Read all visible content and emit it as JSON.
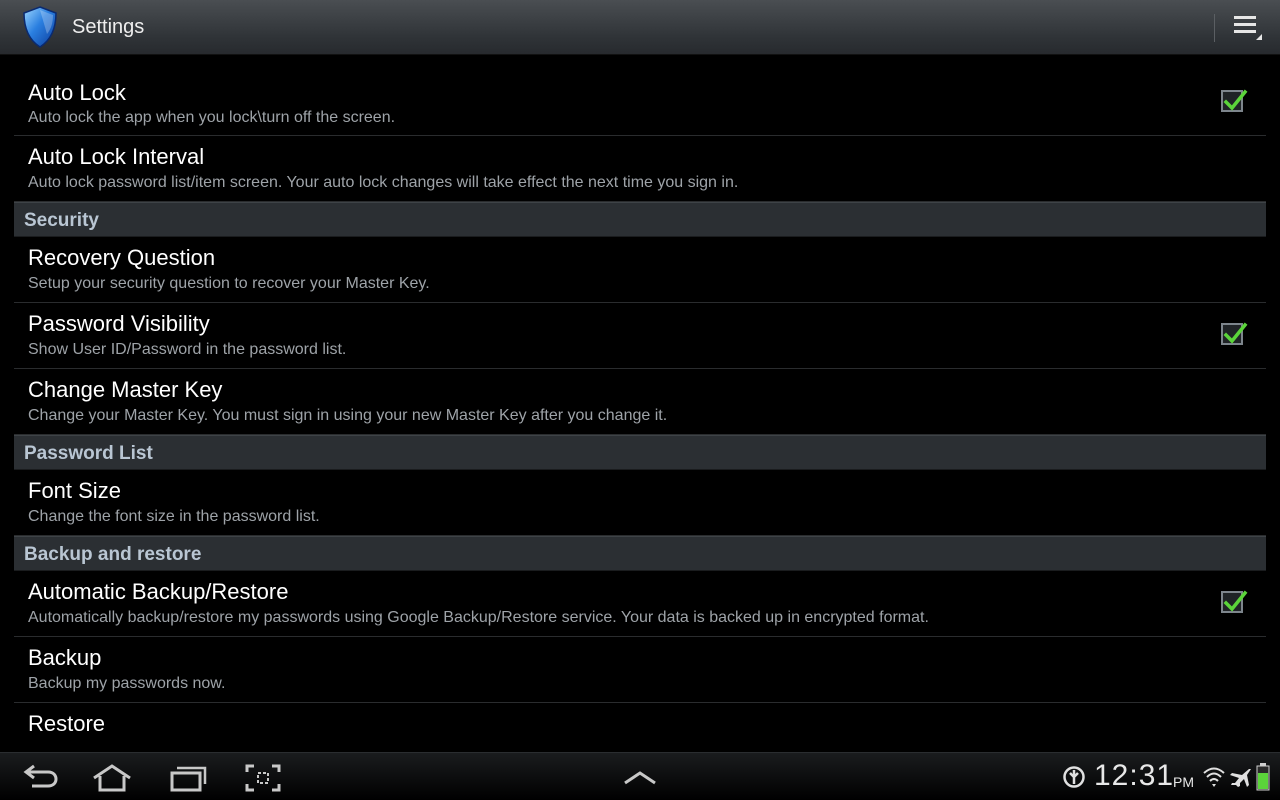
{
  "app": {
    "title": "Settings",
    "icon": "shield-icon",
    "overflow_icon": "overflow-menu-icon"
  },
  "prefs": {
    "auto_lock": {
      "title": "Auto Lock",
      "summary": "Auto lock the app when you lock\\turn off the screen.",
      "checked": true
    },
    "auto_lock_interval": {
      "title": "Auto Lock Interval",
      "summary": "Auto lock password list/item screen. Your auto lock changes will take effect the next time you sign in."
    },
    "security_header": "Security",
    "recovery_question": {
      "title": "Recovery Question",
      "summary": "Setup your security question to recover your Master Key."
    },
    "password_visibility": {
      "title": "Password Visibility",
      "summary": "Show User ID/Password in the password list.",
      "checked": true
    },
    "change_master_key": {
      "title": "Change Master Key",
      "summary": "Change your Master Key. You must sign in using your new Master Key after you change it."
    },
    "password_list_header": "Password List",
    "font_size": {
      "title": "Font Size",
      "summary": "Change the font size in the password list."
    },
    "backup_header": "Backup and restore",
    "automatic_backup": {
      "title": "Automatic Backup/Restore",
      "summary": "Automatically backup/restore my passwords using Google Backup/Restore service. Your data is backed up in encrypted format.",
      "checked": true
    },
    "backup": {
      "title": "Backup",
      "summary": "Backup my passwords now."
    },
    "restore": {
      "title": "Restore",
      "summary": ""
    }
  },
  "system_bar": {
    "time": "12:31",
    "ampm": "PM",
    "icons": [
      "back-icon",
      "home-icon",
      "recent-apps-icon",
      "screenshot-icon",
      "up-arrow-icon",
      "sync-icon",
      "wifi-icon",
      "airplane-mode-icon",
      "battery-icon"
    ]
  },
  "colors": {
    "accent_check": "#5bd43a",
    "category_text": "#b9c6d3",
    "summary_text": "#9ea3a8"
  }
}
